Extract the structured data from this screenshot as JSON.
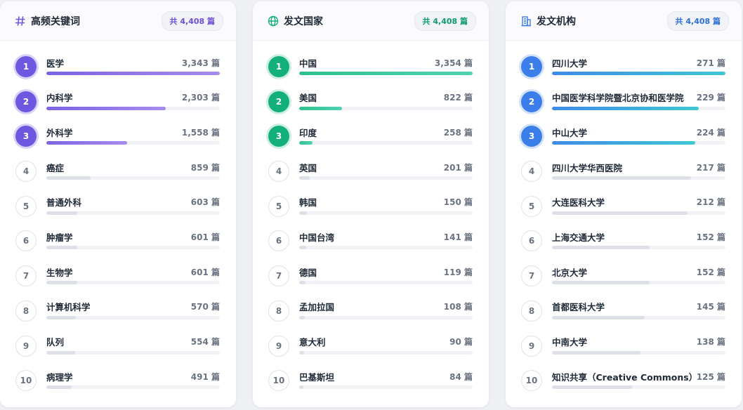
{
  "panels": [
    {
      "title": "高频关键词",
      "icon": "hash-icon",
      "total": "共 4,408 篇",
      "accent": "#6e58e0",
      "items": [
        {
          "rank": "1",
          "name": "医学",
          "count": "3,343 篇",
          "value": 3343
        },
        {
          "rank": "2",
          "name": "内科学",
          "count": "2,303 篇",
          "value": 2303
        },
        {
          "rank": "3",
          "name": "外科学",
          "count": "1,558 篇",
          "value": 1558
        },
        {
          "rank": "4",
          "name": "癌症",
          "count": "859 篇",
          "value": 859
        },
        {
          "rank": "5",
          "name": "普通外科",
          "count": "603 篇",
          "value": 603
        },
        {
          "rank": "6",
          "name": "肿瘤学",
          "count": "601 篇",
          "value": 601
        },
        {
          "rank": "7",
          "name": "生物学",
          "count": "601 篇",
          "value": 601
        },
        {
          "rank": "8",
          "name": "计算机科学",
          "count": "570 篇",
          "value": 570
        },
        {
          "rank": "9",
          "name": "队列",
          "count": "554 篇",
          "value": 554
        },
        {
          "rank": "10",
          "name": "病理学",
          "count": "491 篇",
          "value": 491
        }
      ]
    },
    {
      "title": "发文国家",
      "icon": "globe-icon",
      "total": "共 4,408 篇",
      "accent": "#14b07c",
      "items": [
        {
          "rank": "1",
          "name": "中国",
          "count": "3,354 篇",
          "value": 3354
        },
        {
          "rank": "2",
          "name": "美国",
          "count": "822 篇",
          "value": 822
        },
        {
          "rank": "3",
          "name": "印度",
          "count": "258 篇",
          "value": 258
        },
        {
          "rank": "4",
          "name": "英国",
          "count": "201 篇",
          "value": 201
        },
        {
          "rank": "5",
          "name": "韩国",
          "count": "150 篇",
          "value": 150
        },
        {
          "rank": "6",
          "name": "中国台湾",
          "count": "141 篇",
          "value": 141
        },
        {
          "rank": "7",
          "name": "德国",
          "count": "119 篇",
          "value": 119
        },
        {
          "rank": "8",
          "name": "孟加拉国",
          "count": "108 篇",
          "value": 108
        },
        {
          "rank": "9",
          "name": "意大利",
          "count": "90 篇",
          "value": 90
        },
        {
          "rank": "10",
          "name": "巴基斯坦",
          "count": "84 篇",
          "value": 84
        }
      ]
    },
    {
      "title": "发文机构",
      "icon": "building-icon",
      "total": "共 4,408 篇",
      "accent": "#3b7ee9",
      "items": [
        {
          "rank": "1",
          "name": "四川大学",
          "count": "271 篇",
          "value": 271
        },
        {
          "rank": "2",
          "name": "中国医学科学院暨北京协和医学院",
          "count": "229 篇",
          "value": 229
        },
        {
          "rank": "3",
          "name": "中山大学",
          "count": "224 篇",
          "value": 224
        },
        {
          "rank": "4",
          "name": "四川大学华西医院",
          "count": "217 篇",
          "value": 217
        },
        {
          "rank": "5",
          "name": "大连医科大学",
          "count": "212 篇",
          "value": 212
        },
        {
          "rank": "6",
          "name": "上海交通大学",
          "count": "152 篇",
          "value": 152
        },
        {
          "rank": "7",
          "name": "北京大学",
          "count": "152 篇",
          "value": 152
        },
        {
          "rank": "8",
          "name": "首都医科大学",
          "count": "145 篇",
          "value": 145
        },
        {
          "rank": "9",
          "name": "中南大学",
          "count": "138 篇",
          "value": 138
        },
        {
          "rank": "10",
          "name": "知识共享（Creative Commons）",
          "count": "125 篇",
          "value": 125
        }
      ]
    }
  ]
}
